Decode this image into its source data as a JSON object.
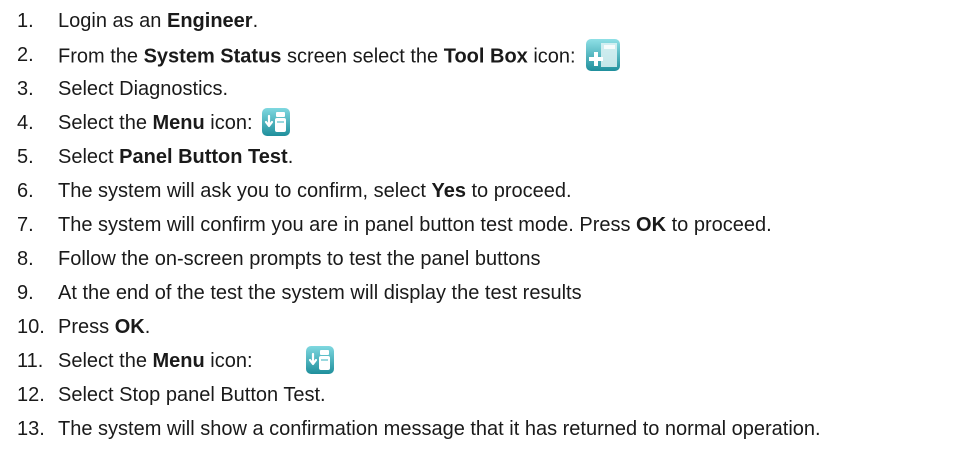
{
  "steps": [
    {
      "num": "1.",
      "parts": [
        "Login as an ",
        "Engineer",
        "."
      ]
    },
    {
      "num": "2.",
      "parts": [
        "From the ",
        "System Status",
        " screen select the ",
        "Tool Box",
        " icon:"
      ],
      "icon": "toolbox-icon"
    },
    {
      "num": "3.",
      "parts": [
        "Select Diagnostics."
      ]
    },
    {
      "num": "4.",
      "parts": [
        "Select the ",
        "Menu",
        " icon:"
      ],
      "icon": "menu-icon"
    },
    {
      "num": "5.",
      "parts": [
        "Select ",
        "Panel Button Test",
        "."
      ]
    },
    {
      "num": "6.",
      "parts": [
        "The system will ask you to confirm, select ",
        "Yes",
        " to proceed."
      ]
    },
    {
      "num": "7.",
      "parts": [
        "The system will confirm you are in panel button test mode. Press ",
        "OK",
        " to proceed."
      ]
    },
    {
      "num": "8.",
      "parts": [
        "Follow the on-screen prompts to test the panel buttons"
      ]
    },
    {
      "num": "9.",
      "parts": [
        "At the end of the test the system will display the test results"
      ]
    },
    {
      "num": "10.",
      "parts": [
        "Press ",
        "OK",
        "."
      ]
    },
    {
      "num": "11.",
      "parts": [
        "Select the ",
        "Menu",
        " icon:"
      ],
      "icon": "menu-icon"
    },
    {
      "num": "12.",
      "parts": [
        "Select Stop panel Button Test."
      ]
    },
    {
      "num": "13.",
      "parts": [
        "The system will show a confirmation message that it has returned to normal operation."
      ]
    }
  ],
  "icon_colors": {
    "teal_light": "#6fd3dc",
    "teal_dark": "#1f8f9c",
    "white": "#ffffff"
  }
}
